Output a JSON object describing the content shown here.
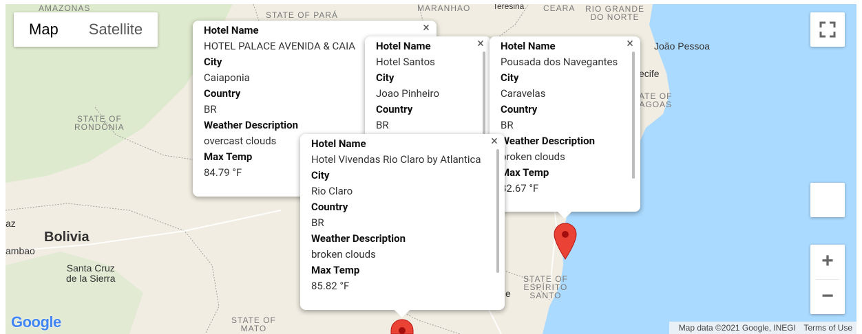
{
  "map_type": {
    "map_label": "Map",
    "satellite_label": "Satellite"
  },
  "labels": {
    "amazonas": "AMAZONAS",
    "para": "STATE OF PARÁ",
    "maranhao": "MARANHAO",
    "teresina": "Teresina",
    "ceara": "CEARA",
    "rgn": "RIO GRANDE\nDO NORTE",
    "joao_pessoa": "João Pessoa",
    "recife": "ecife",
    "alagoas": "ATE OF\nAGOAS",
    "rondonia": "STATE OF\nRONDÔNIA",
    "bolivia": "Bolivia",
    "az": "az",
    "ambao": "ambao",
    "santa_cruz": "Santa Cruz\nde la Sierra",
    "mato": "STATE OF\nMATO",
    "espirito": "STATE OF\nESPÍRITO\nSANTO",
    "e_frag": "e"
  },
  "infowindows": [
    {
      "hotel_name_label": "Hotel Name",
      "hotel_name": "HOTEL PALACE AVENIDA & CAIA",
      "city_label": "City",
      "city": "Caiaponia",
      "country_label": "Country",
      "country": "BR",
      "weather_label": "Weather Description",
      "weather": "overcast clouds",
      "temp_label": "Max Temp",
      "temp": "84.79 °F"
    },
    {
      "hotel_name_label": "Hotel Name",
      "hotel_name": "Hotel Santos",
      "city_label": "City",
      "city": "Joao Pinheiro",
      "country_label": "Country",
      "country": "BR"
    },
    {
      "hotel_name_label": "Hotel Name",
      "hotel_name": "Pousada dos Navegantes",
      "city_label": "City",
      "city": "Caravelas",
      "country_label": "Country",
      "country": "BR",
      "weather_label": "Weather Description",
      "weather": "broken clouds",
      "temp_label": "Max Temp",
      "temp": "82.67 °F"
    },
    {
      "hotel_name_label": "Hotel Name",
      "hotel_name": "Hotel Vivendas Rio Claro by Atlantica",
      "city_label": "City",
      "city": "Rio Claro",
      "country_label": "Country",
      "country": "BR",
      "weather_label": "Weather Description",
      "weather": "broken clouds",
      "temp_label": "Max Temp",
      "temp": "85.82 °F"
    }
  ],
  "close_glyph": "×",
  "zoom": {
    "in": "+",
    "out": "−"
  },
  "google_logo": "Google",
  "attribution": {
    "data": "Map data ©2021 Google, INEGI",
    "terms": "Terms of Use"
  }
}
